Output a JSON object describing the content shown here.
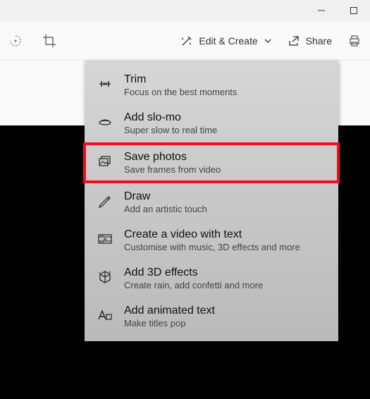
{
  "toolbar": {
    "edit_create_label": "Edit & Create",
    "share_label": "Share"
  },
  "menu": {
    "items": [
      {
        "title": "Trim",
        "desc": "Focus on the best moments"
      },
      {
        "title": "Add slo-mo",
        "desc": "Super slow to real time"
      },
      {
        "title": "Save photos",
        "desc": "Save frames from video"
      },
      {
        "title": "Draw",
        "desc": "Add an artistic touch"
      },
      {
        "title": "Create a video with text",
        "desc": "Customise with music, 3D effects and more"
      },
      {
        "title": "Add 3D effects",
        "desc": "Create rain, add confetti and more"
      },
      {
        "title": "Add animated text",
        "desc": "Make titles pop"
      }
    ],
    "highlighted_index": 2
  }
}
